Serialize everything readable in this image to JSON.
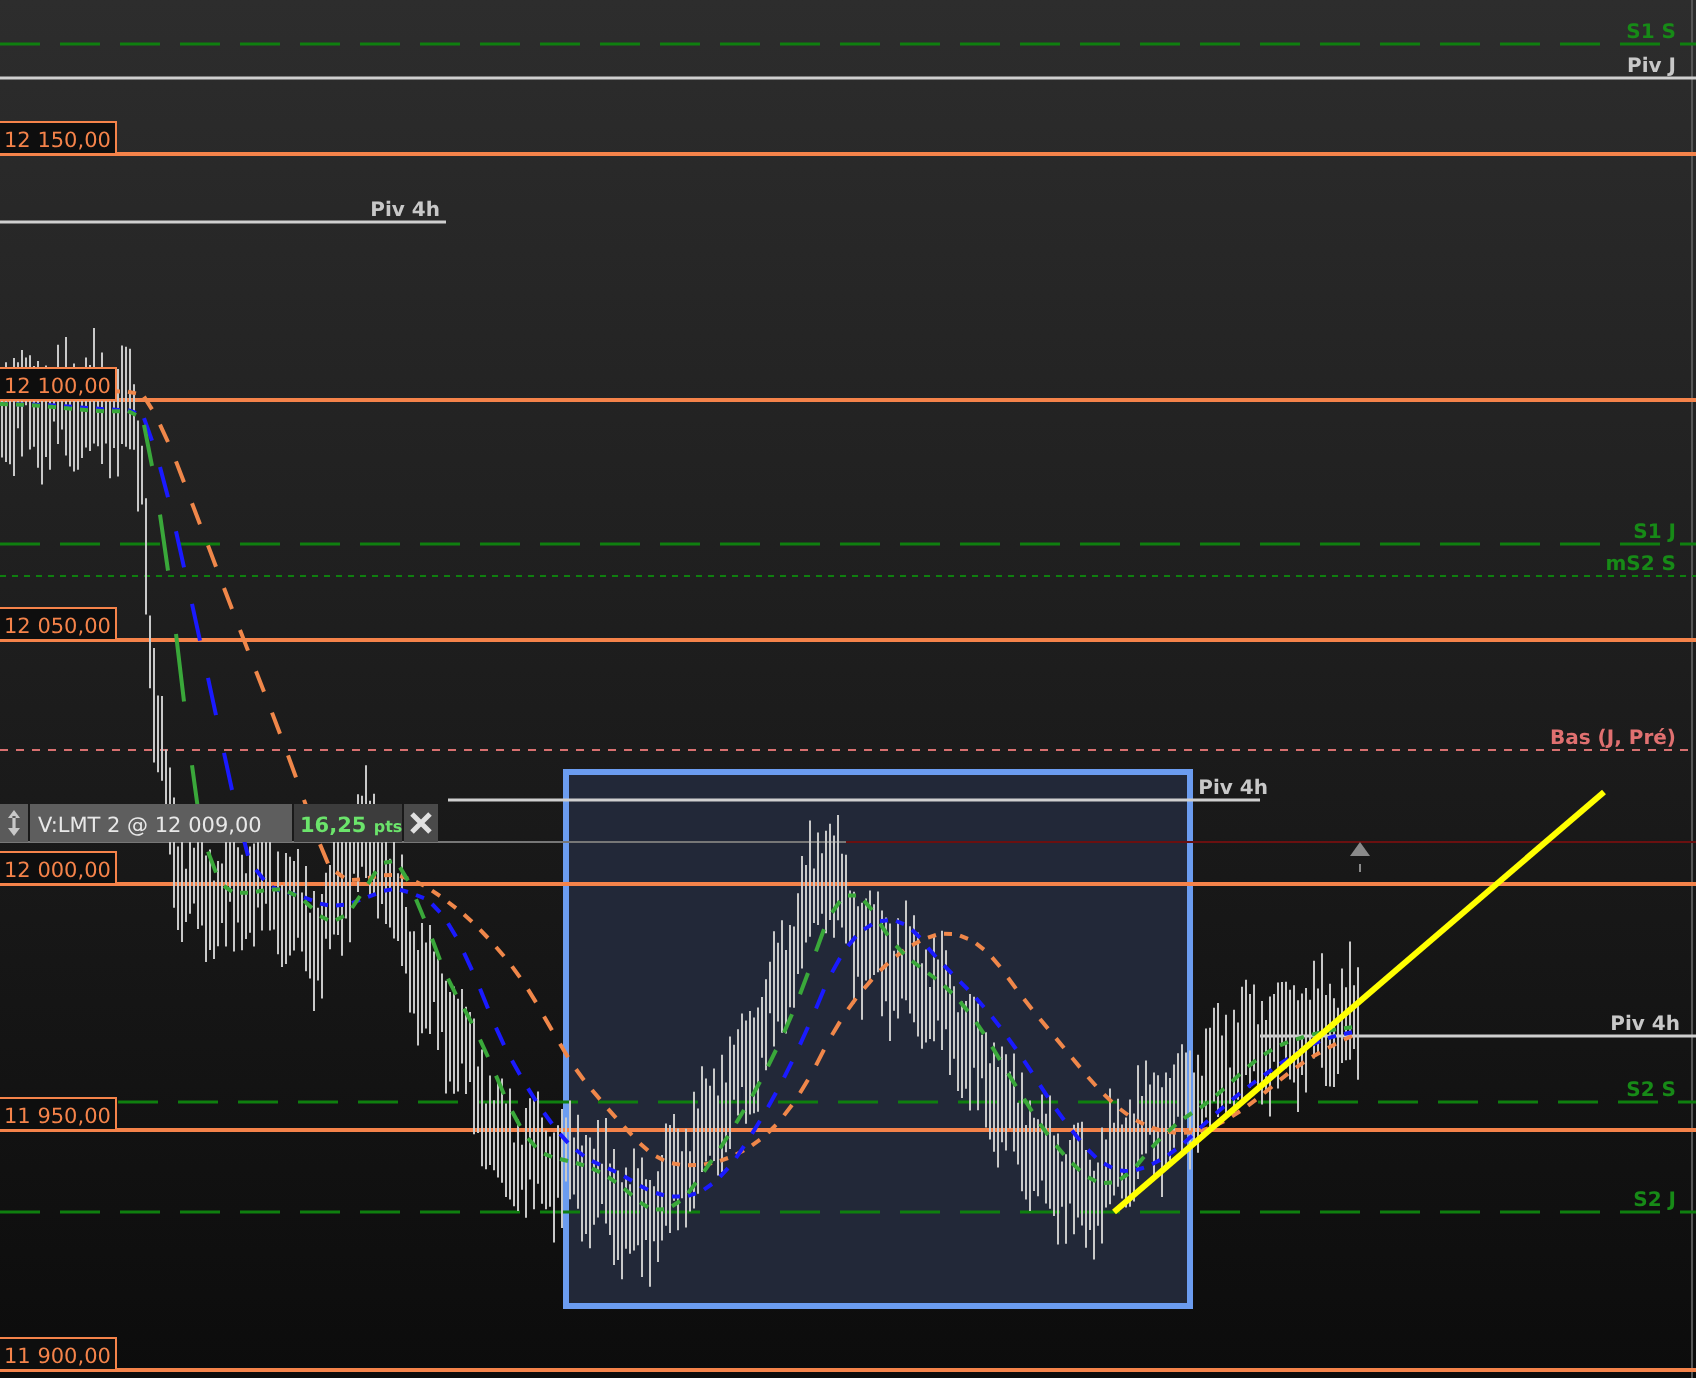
{
  "price_labels": [
    {
      "label": "12 150,00"
    },
    {
      "label": "12 100,00"
    },
    {
      "label": "12 050,00"
    },
    {
      "label": "12 000,00"
    },
    {
      "label": "11 950,00"
    },
    {
      "label": "11 900,00"
    }
  ],
  "level_lines": [
    {
      "label": "S1 S",
      "kind": "support"
    },
    {
      "label": "Piv J",
      "kind": "pivot"
    },
    {
      "label": "Piv 4h",
      "kind": "pivot"
    },
    {
      "label": "S1 J",
      "kind": "support"
    },
    {
      "label": "mS2 S",
      "kind": "minor"
    },
    {
      "label": "Bas (J, Pré)",
      "kind": "low"
    },
    {
      "label": "Piv 4h",
      "kind": "pivot"
    },
    {
      "label": "Piv 4h",
      "kind": "pivot"
    },
    {
      "label": "S2 S",
      "kind": "support"
    },
    {
      "label": "S2 J",
      "kind": "support"
    }
  ],
  "order_ticket": {
    "side": "V:LMT",
    "quantity": "2",
    "at": "@",
    "price": "12 009,00",
    "profit": "16,25",
    "unit": "pts"
  }
}
